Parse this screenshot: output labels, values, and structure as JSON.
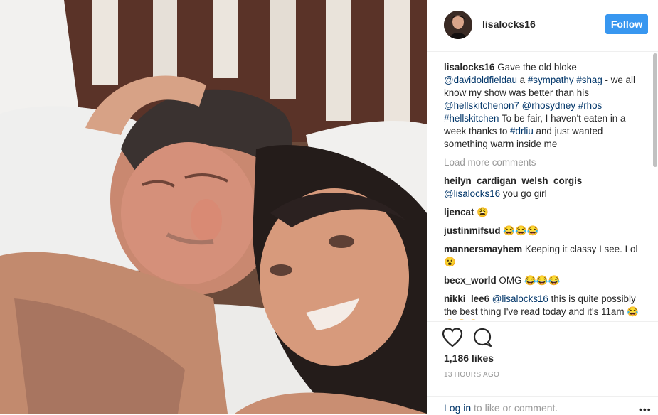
{
  "post": {
    "username": "lisalocks16",
    "follow_label": "Follow"
  },
  "comments": [
    {
      "user": "lisalocks16",
      "parts": [
        {
          "t": "Gave the old bloke ",
          "k": "text"
        },
        {
          "t": "@davidoldfieldau",
          "k": "tag"
        },
        {
          "t": " a ",
          "k": "text"
        },
        {
          "t": "#sympathy",
          "k": "tag"
        },
        {
          "t": " ",
          "k": "text"
        },
        {
          "t": "#shag",
          "k": "tag"
        },
        {
          "t": " - we all know my show was better than his ",
          "k": "text"
        },
        {
          "t": "@hellskitchenon7",
          "k": "tag"
        },
        {
          "t": " ",
          "k": "text"
        },
        {
          "t": "@rhosydney",
          "k": "tag"
        },
        {
          "t": " ",
          "k": "text"
        },
        {
          "t": "#rhos",
          "k": "tag"
        },
        {
          "t": " ",
          "k": "text"
        },
        {
          "t": "#hellskitchen",
          "k": "tag"
        },
        {
          "t": " To be fair, I haven't eaten in a week thanks to ",
          "k": "text"
        },
        {
          "t": "#drliu",
          "k": "tag"
        },
        {
          "t": " and just wanted something warm inside me",
          "k": "text"
        }
      ]
    },
    {
      "load_more": "Load more comments"
    },
    {
      "user": "heilyn_cardigan_welsh_corgis",
      "parts": [
        {
          "t": "@lisalocks16",
          "k": "tag"
        },
        {
          "t": " you go girl",
          "k": "text"
        }
      ]
    },
    {
      "user": "ljencat",
      "parts": [
        {
          "t": "😩",
          "k": "text"
        }
      ]
    },
    {
      "user": "justinmifsud",
      "parts": [
        {
          "t": "😂😂😂",
          "k": "text"
        }
      ]
    },
    {
      "user": "mannersmayhem",
      "parts": [
        {
          "t": "Keeping it classy I see. Lol 😮",
          "k": "text"
        }
      ]
    },
    {
      "user": "becx_world",
      "parts": [
        {
          "t": "OMG 😂😂😂",
          "k": "text"
        }
      ]
    },
    {
      "user": "nikki_lee6",
      "parts": [
        {
          "t": "@lisalocks16",
          "k": "tag"
        },
        {
          "t": " this is quite possibly the best thing I've read today and it's 11am 😂😂😂😂",
          "k": "text"
        }
      ]
    }
  ],
  "footer": {
    "likes": "1,186 likes",
    "time": "13 HOURS AGO",
    "login_link": "Log in",
    "login_rest": " to like or comment.",
    "more": "•••"
  },
  "icons": {
    "like": "heart-icon",
    "comment": "speech-bubble-icon",
    "more": "ellipsis-icon"
  },
  "colors": {
    "follow_button": "#3897f0",
    "link": "#003569",
    "muted": "#999999"
  }
}
